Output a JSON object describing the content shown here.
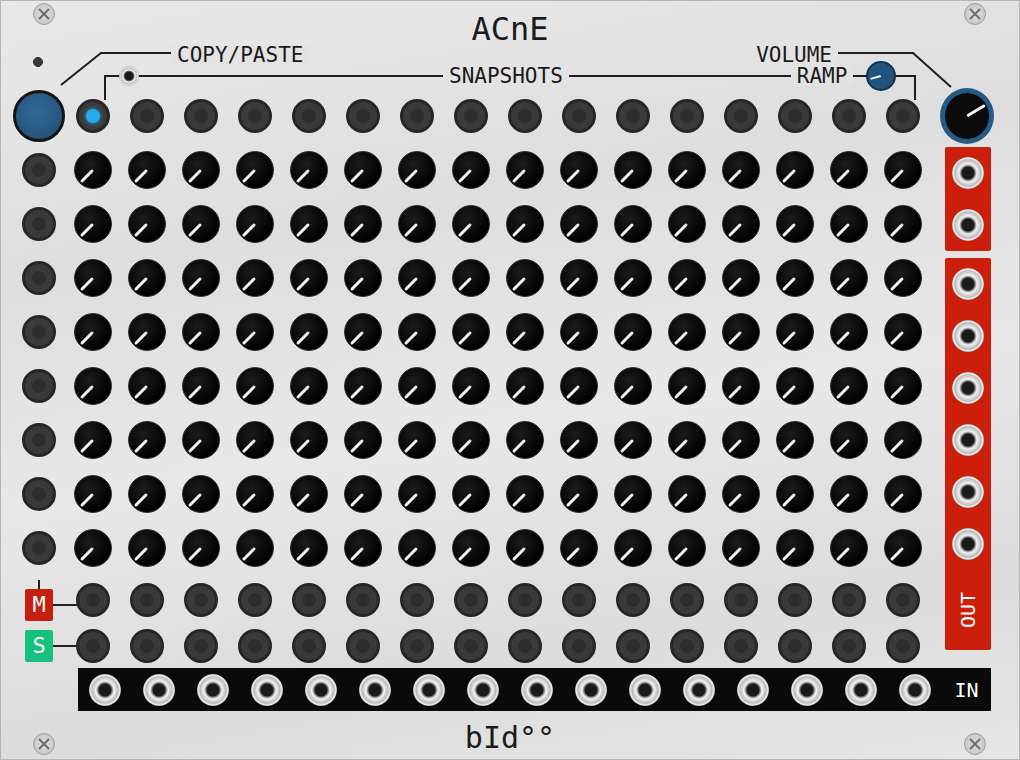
{
  "panel": {
    "title": "ACnE",
    "brand": "bId°°"
  },
  "copy_paste": {
    "label": "COPY/PASTE",
    "led_on": false
  },
  "labels": {
    "snapshots": "SNAPSHOTS",
    "mute": "M",
    "solo": "S",
    "inputs": "IN",
    "outputs": "OUT"
  },
  "volume": {
    "label": "VOLUME",
    "level": 0.72
  },
  "ramp": {
    "label": "RAMP",
    "level": 0.11
  },
  "snapshots": [
    {
      "selected": true
    },
    {
      "selected": false
    },
    {
      "selected": false
    },
    {
      "selected": false
    },
    {
      "selected": false
    },
    {
      "selected": false
    },
    {
      "selected": false
    },
    {
      "selected": false
    },
    {
      "selected": false
    },
    {
      "selected": false
    },
    {
      "selected": false
    },
    {
      "selected": false
    },
    {
      "selected": false
    },
    {
      "selected": false
    },
    {
      "selected": false
    },
    {
      "selected": false
    }
  ],
  "rows": [
    {
      "levels": [
        0,
        0,
        0,
        0,
        0,
        0,
        0,
        0,
        0,
        0,
        0,
        0,
        0,
        0,
        0,
        0
      ]
    },
    {
      "levels": [
        0,
        0,
        0,
        0,
        0,
        0,
        0,
        0,
        0,
        0,
        0,
        0,
        0,
        0,
        0,
        0
      ]
    },
    {
      "levels": [
        0,
        0,
        0,
        0,
        0,
        0,
        0,
        0,
        0,
        0,
        0,
        0,
        0,
        0,
        0,
        0
      ]
    },
    {
      "levels": [
        0,
        0,
        0,
        0,
        0,
        0,
        0,
        0,
        0,
        0,
        0,
        0,
        0,
        0,
        0,
        0
      ]
    },
    {
      "levels": [
        0,
        0,
        0,
        0,
        0,
        0,
        0,
        0,
        0,
        0,
        0,
        0,
        0,
        0,
        0,
        0
      ]
    },
    {
      "levels": [
        0,
        0,
        0,
        0,
        0,
        0,
        0,
        0,
        0,
        0,
        0,
        0,
        0,
        0,
        0,
        0
      ]
    },
    {
      "levels": [
        0,
        0,
        0,
        0,
        0,
        0,
        0,
        0,
        0,
        0,
        0,
        0,
        0,
        0,
        0,
        0
      ]
    },
    {
      "levels": [
        0,
        0,
        0,
        0,
        0,
        0,
        0,
        0,
        0,
        0,
        0,
        0,
        0,
        0,
        0,
        0
      ]
    }
  ]
}
